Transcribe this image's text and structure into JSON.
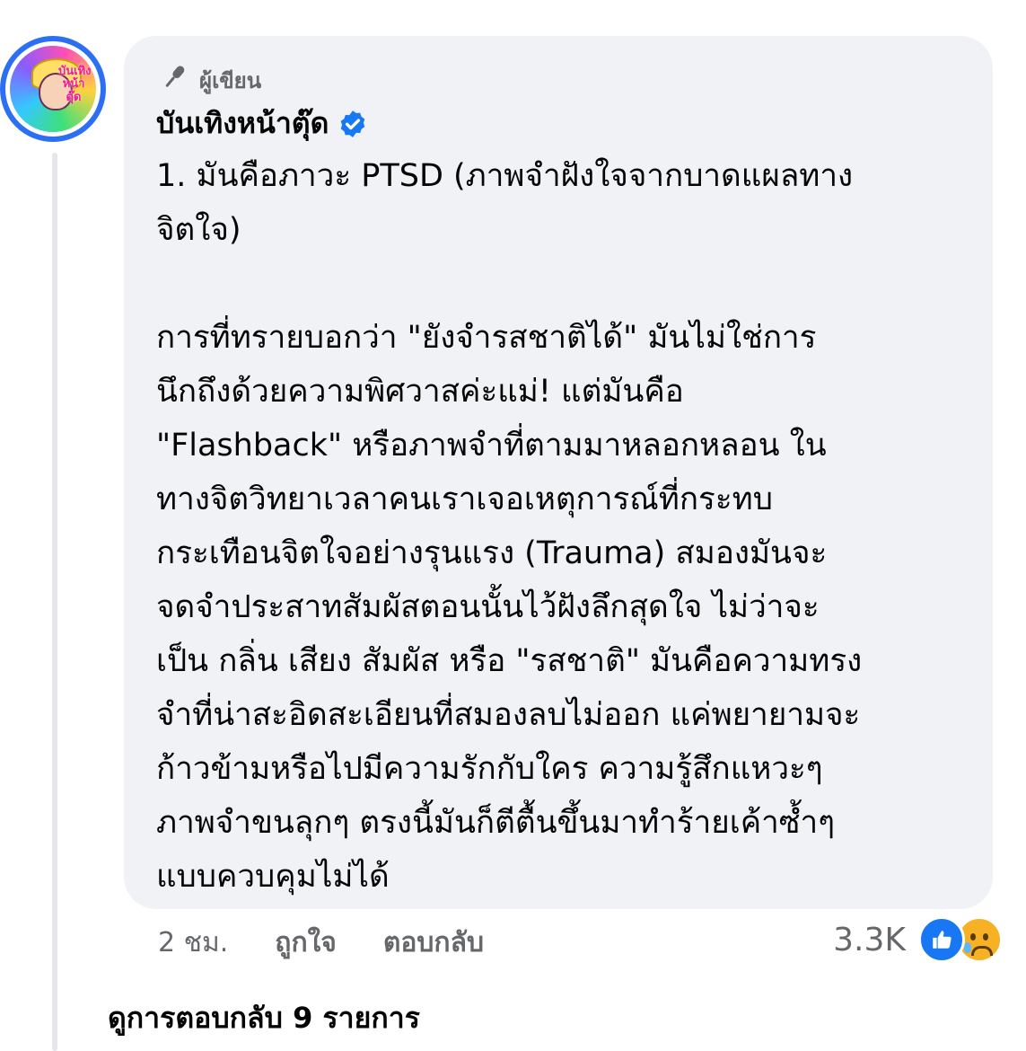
{
  "comment": {
    "avatar_text": "บันเทิง หน้า ตุ๊ด",
    "role_label": "ผู้เขียน",
    "author_name": "บันเทิงหน้าตุ๊ด",
    "body_lines_p1": [
      "1. มันคือภาวะ PTSD (ภาพจำฝังใจจากบาดแผลทาง",
      "จิตใจ)"
    ],
    "body_lines_p2": [
      "การที่ทรายบอกว่า \"ยังจำรสชาติได้\" มันไม่ใช่การ",
      "นึกถึงด้วยความพิศวาสค่ะแม่! แต่มันคือ",
      "\"Flashback\" หรือภาพจำที่ตามมาหลอกหลอน ใน",
      "ทางจิตวิทยาเวลาคนเราเจอเหตุการณ์ที่กระทบ",
      "กระเทือนจิตใจอย่างรุนแรง (Trauma) สมองมันจะ",
      "จดจำประสาทสัมผัสตอนนั้นไว้ฝังลึกสุดใจ ไม่ว่าจะ",
      "เป็น กลิ่น เสียง สัมผัส หรือ \"รสชาติ\" มันคือความทรง",
      "จำที่น่าสะอิดสะเอียนที่สมองลบไม่ออก แค่พยายามจะ",
      "ก้าวข้ามหรือไปมีความรักกับใคร ความรู้สึกแหวะๆ",
      "ภาพจำขนลุกๆ ตรงนี้มันก็ตีตื้นขึ้นมาทำร้ายเค้าซ้ำๆ",
      "แบบควบคุมไม่ได้"
    ],
    "time": "2 ชม.",
    "like_label": "ถูกใจ",
    "reply_label": "ตอบกลับ",
    "reaction_count": "3.3K",
    "reaction_icons": [
      "like-icon",
      "sad-icon"
    ],
    "view_replies": "ดูการตอบกลับ 9 รายการ"
  },
  "colors": {
    "bubble": "#f0f2f5",
    "accent": "#1877f2",
    "muted": "#65676b"
  }
}
